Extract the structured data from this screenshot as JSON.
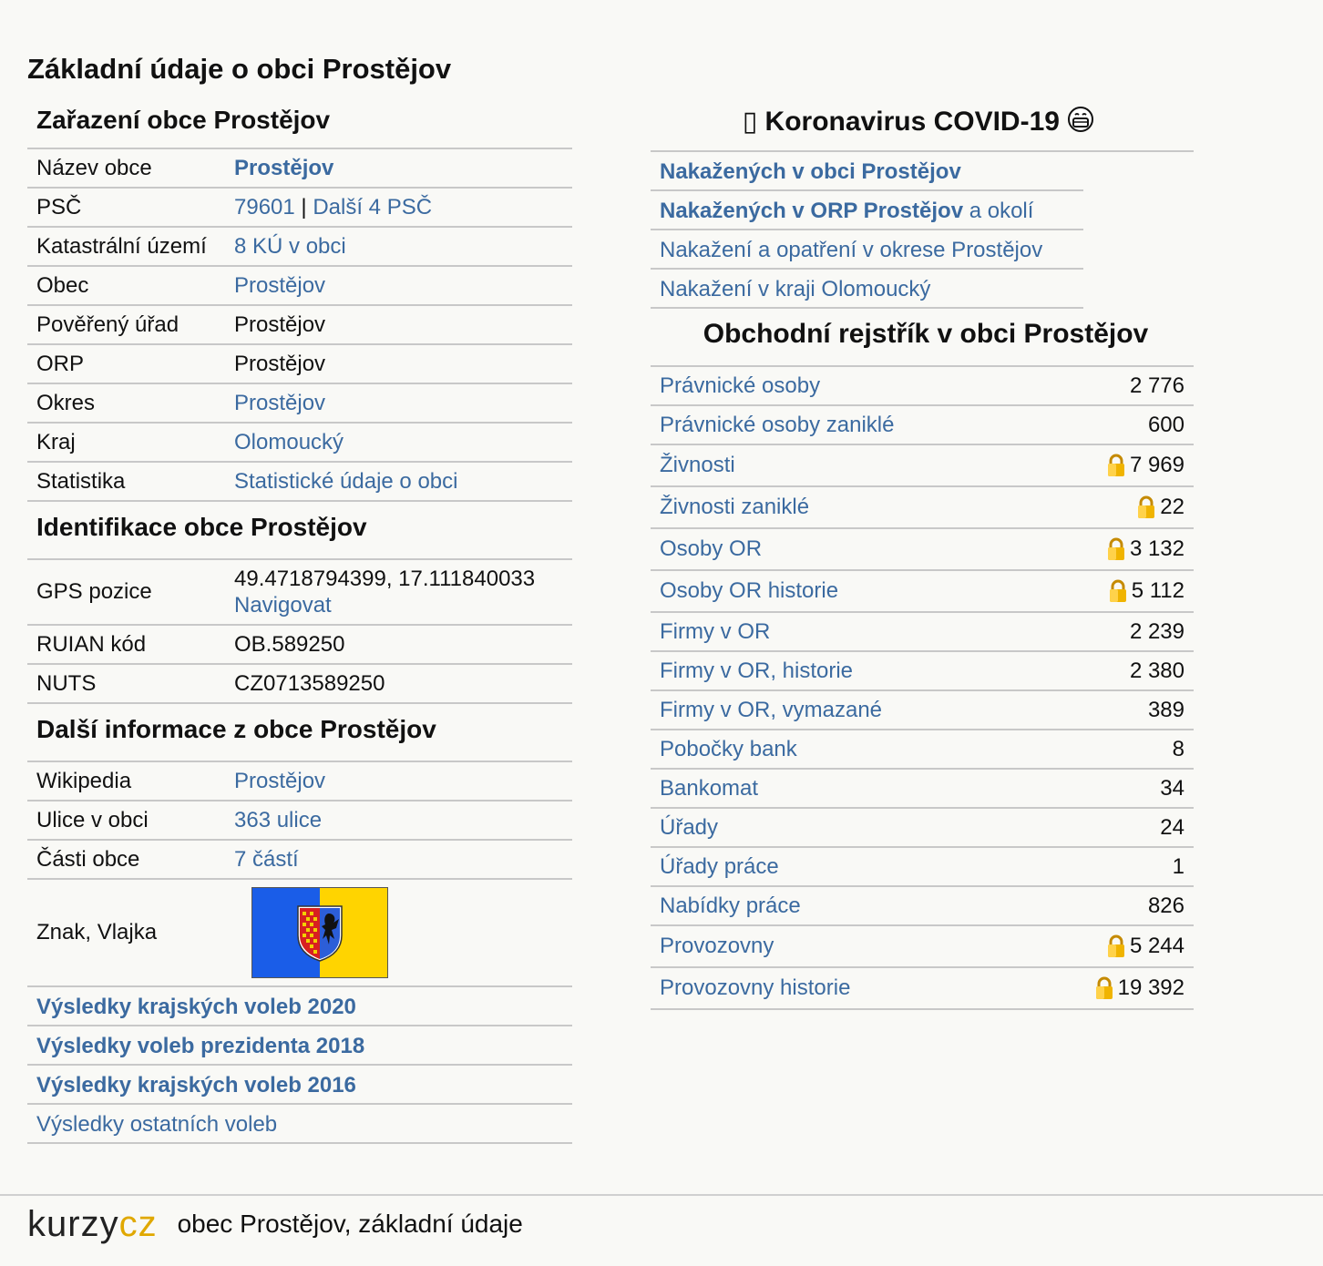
{
  "page_title": "Základní údaje o obci Prostějov",
  "classification": {
    "heading": "Zařazení obce Prostějov",
    "rows": [
      {
        "label": "Název obce",
        "value": "Prostějov"
      },
      {
        "label": "PSČ",
        "value_link": "79601",
        "sep": " | ",
        "value_link2": "Další 4 PSČ"
      },
      {
        "label": "Katastrální území",
        "value": "8 KÚ v obci"
      },
      {
        "label": "Obec",
        "value": "Prostějov"
      },
      {
        "label": "Pověřený úřad",
        "value": "Prostějov"
      },
      {
        "label": "ORP",
        "value": "Prostějov"
      },
      {
        "label": "Okres",
        "value": "Prostějov"
      },
      {
        "label": "Kraj",
        "value": "Olomoucký"
      },
      {
        "label": "Statistika",
        "value": "Statistické údaje o obci"
      }
    ]
  },
  "identification": {
    "heading": "Identifikace obce Prostějov",
    "gps_label": "GPS pozice",
    "gps_value": "49.4718794399, 17.111840033",
    "gps_link": "Navigovat",
    "ruian_label": "RUIAN kód",
    "ruian_value": "OB.589250",
    "nuts_label": "NUTS",
    "nuts_value": "CZ0713589250"
  },
  "more_info": {
    "heading": "Další informace z obce Prostějov",
    "rows": [
      {
        "label": "Wikipedia",
        "value": "Prostějov"
      },
      {
        "label": "Ulice v obci",
        "value": "363 ulice"
      },
      {
        "label": "Části obce",
        "value": "7 částí"
      }
    ],
    "flag_label": "Znak, Vlajka",
    "flag_colors": {
      "left": "#1a5de8",
      "right": "#ffd400"
    }
  },
  "election_links": [
    "Výsledky krajských voleb 2020",
    "Výsledky voleb prezidenta 2018",
    "Výsledky krajských voleb 2016",
    "Výsledky ostatních voleb"
  ],
  "covid": {
    "heading_icon": "▯",
    "heading_text": "Koronavirus COVID-19",
    "heading_emoji": "😷",
    "links": [
      {
        "bold": "Nakažených v obci Prostějov",
        "rest": ""
      },
      {
        "bold": "Nakažených v ORP Prostějov",
        "rest": " a okolí"
      },
      {
        "bold": "",
        "rest": "Nakažení a opatření v okrese Prostějov"
      },
      {
        "bold": "",
        "rest": "Nakažení v kraji Olomoucký"
      }
    ]
  },
  "register": {
    "heading": "Obchodní rejstřík v obci Prostějov",
    "rows": [
      {
        "label": "Právnické osoby",
        "value": "2 776",
        "locked": false
      },
      {
        "label": "Právnické osoby zaniklé",
        "value": "600",
        "locked": false
      },
      {
        "label": "Živnosti",
        "value": "7 969",
        "locked": true
      },
      {
        "label": "Živnosti zaniklé",
        "value": "22",
        "locked": true
      },
      {
        "label": "Osoby OR",
        "value": "3 132",
        "locked": true
      },
      {
        "label": "Osoby OR historie",
        "value": "5 112",
        "locked": true
      },
      {
        "label": "Firmy v OR",
        "value": "2 239",
        "locked": false
      },
      {
        "label": "Firmy v OR, historie",
        "value": "2 380",
        "locked": false
      },
      {
        "label": "Firmy v OR, vymazané",
        "value": "389",
        "locked": false
      },
      {
        "label": "Pobočky bank",
        "value": "8",
        "locked": false
      },
      {
        "label": "Bankomat",
        "value": "34",
        "locked": false
      },
      {
        "label": "Úřady",
        "value": "24",
        "locked": false
      },
      {
        "label": "Úřady práce",
        "value": "1",
        "locked": false
      },
      {
        "label": "Nabídky práce",
        "value": "826",
        "locked": false
      },
      {
        "label": "Provozovny",
        "value": "5 244",
        "locked": true
      },
      {
        "label": "Provozovny historie",
        "value": "19 392",
        "locked": true
      }
    ]
  },
  "footer": {
    "logo_part1": "kurzy",
    "logo_part2": "cz",
    "text": "obec Prostějov, základní údaje"
  }
}
